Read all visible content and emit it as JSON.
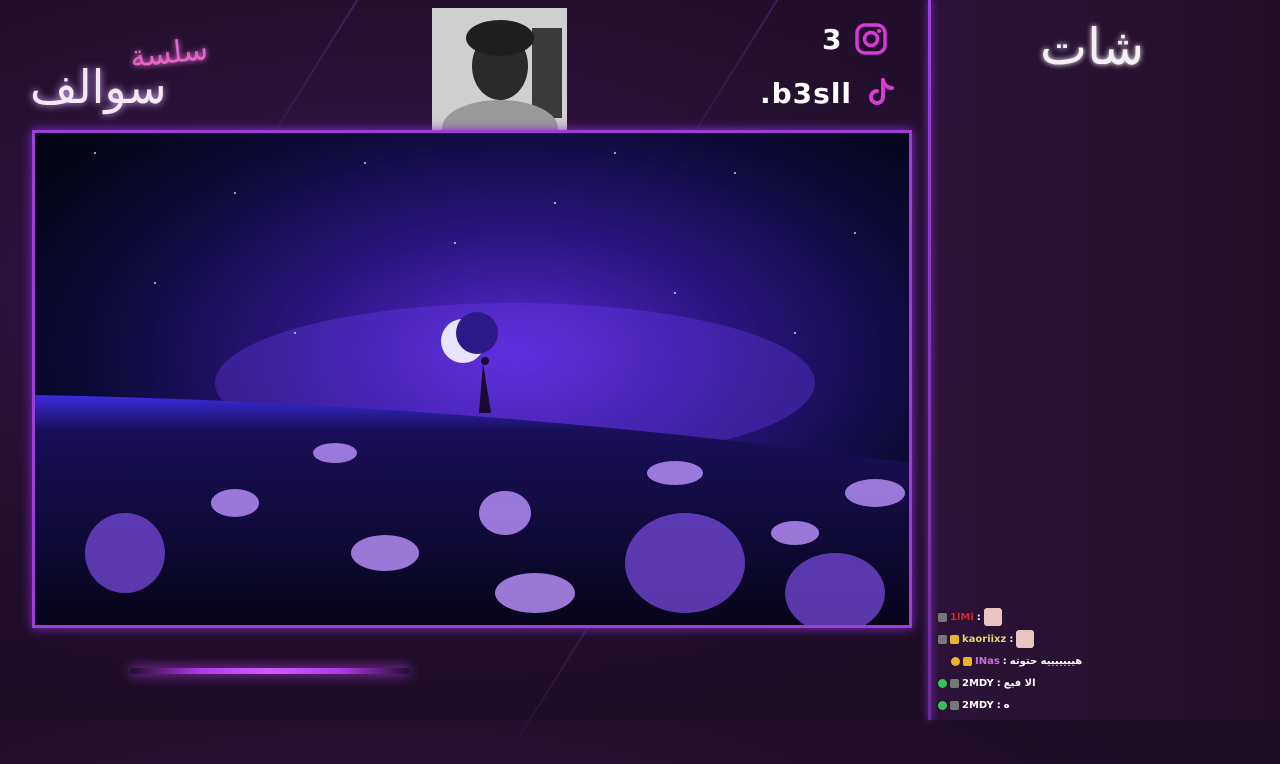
{
  "brand": {
    "main": "سوالف",
    "sub": "سلسة"
  },
  "social": {
    "instagram_handle": "3",
    "tiktok_handle": ".b3sll",
    "instagram_icon": "instagram-icon",
    "tiktok_icon": "tiktok-icon"
  },
  "chat": {
    "title": "شات",
    "messages": [
      {
        "user": "1lMi",
        "sep": " :",
        "text": "",
        "color": "#d02a2a",
        "emote": true
      },
      {
        "user": "kaoriixz",
        "sep": " :",
        "text": "",
        "color": "#e6d36a",
        "emote": true
      },
      {
        "user": "INas",
        "sep": " : ",
        "text": "هيييييييه حتوته",
        "color": "#c86de0",
        "emote": false
      },
      {
        "user": "2MDY",
        "sep": " : ",
        "text": "الا فيع",
        "color": "#ffffff",
        "emote": false
      },
      {
        "user": "2MDY",
        "sep": " : ",
        "text": "ه",
        "color": "#ffffff",
        "emote": false
      }
    ]
  },
  "colors": {
    "accent": "#9b3fd6",
    "glow": "#b13ae8",
    "panel": "#2a1234"
  }
}
